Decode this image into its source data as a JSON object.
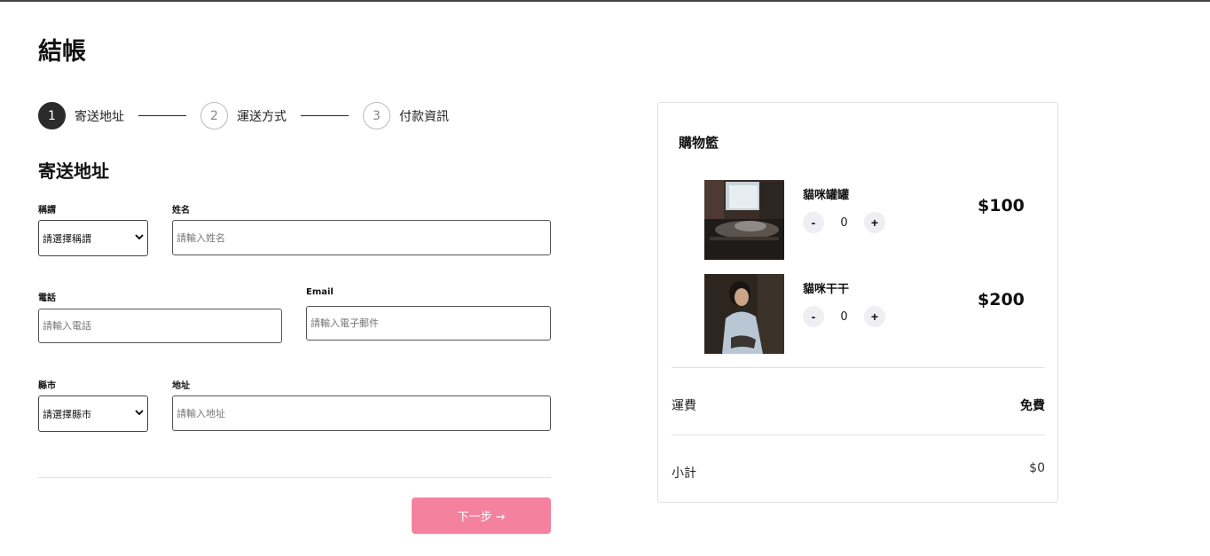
{
  "page": {
    "title": "結帳"
  },
  "stepper": {
    "steps": [
      {
        "number": "1",
        "label": "寄送地址"
      },
      {
        "number": "2",
        "label": "運送方式"
      },
      {
        "number": "3",
        "label": "付款資訊"
      }
    ],
    "active_step": 1
  },
  "form": {
    "section_title": "寄送地址",
    "salutation": {
      "label": "稱謂",
      "value": "請選擇稱謂"
    },
    "name": {
      "label": "姓名",
      "placeholder": "請輸入姓名"
    },
    "phone": {
      "label": "電話",
      "placeholder": "請輸入電話"
    },
    "email": {
      "label": "Email",
      "placeholder": "請輸入電子郵件"
    },
    "city": {
      "label": "縣市",
      "value": "請選擇縣市"
    },
    "address": {
      "label": "地址",
      "placeholder": "請輸入地址"
    },
    "next_button": "下一步 →"
  },
  "cart": {
    "title": "購物籃",
    "items": [
      {
        "name": "貓咪罐罐",
        "quantity": "0",
        "price": "$100",
        "minus": "-",
        "plus": "+"
      },
      {
        "name": "貓咪干干",
        "quantity": "0",
        "price": "$200",
        "minus": "-",
        "plus": "+"
      }
    ],
    "shipping": {
      "label": "運費",
      "value": "免費"
    },
    "subtotal": {
      "label": "小計",
      "value": "$0"
    }
  },
  "colors": {
    "accent": "#f4829f",
    "step_active": "#2b2b2b"
  }
}
